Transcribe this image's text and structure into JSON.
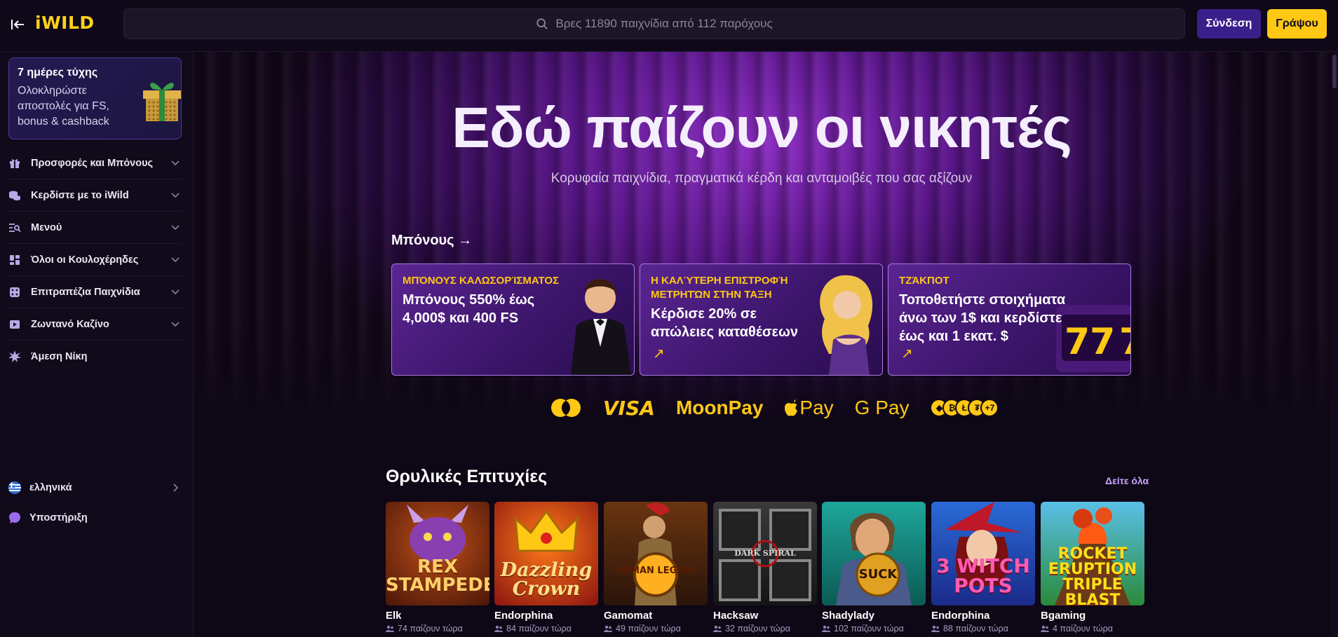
{
  "header": {
    "logo": "iWILD",
    "search_placeholder": "Βρες 11890 παιχνίδια από 112 παρόχους",
    "login_label": "Σύνδεση",
    "register_label": "Γράψου"
  },
  "sidebar": {
    "promo": {
      "title": "7 ημέρες τύχης",
      "text": "Ολοκληρώστε αποστολές για FS, bonus & cashback"
    },
    "items": [
      {
        "label": "Προσφορές και Μπόνους",
        "icon": "gift-icon",
        "expandable": true
      },
      {
        "label": "Κερδίστε με το iWild",
        "icon": "coins-icon",
        "expandable": true
      },
      {
        "label": "Μενού",
        "icon": "menu-search-icon",
        "expandable": true
      },
      {
        "label": "Όλοι οι Κουλοχέρηδες",
        "icon": "grid-icon",
        "expandable": true
      },
      {
        "label": "Επιτραπέζια Παιχνίδια",
        "icon": "dice-icon",
        "expandable": true
      },
      {
        "label": "Ζωντανό Καζίνο",
        "icon": "play-icon",
        "expandable": true
      },
      {
        "label": "Άμεση Νίκη",
        "icon": "burst-icon",
        "expandable": false
      }
    ],
    "language": "ελληνικά",
    "support": "Υποστήριξη"
  },
  "hero": {
    "title": "Εδώ παίζουν οι νικητές",
    "subtitle": "Κορυφαία παιχνίδια, πραγματικά κέρδη και ανταμοιβές που σας αξίζουν"
  },
  "bonus_section": {
    "heading": "Μπόνους →",
    "cards": [
      {
        "tag": "ΜΠΌΝΟΥΣ ΚΑΛΩΣΟΡΊΣΜΑΤΟΣ",
        "text": "Μπόνους 550% έως 4,000$ και 400 FS"
      },
      {
        "tag": "Η ΚΑΛΎΤΕΡΗ ΕΠΙΣΤΡΟΦΉ ΜΕΤΡΗΤΏΝ ΣΤΗΝ ΤΑΞΗ",
        "text": "Κέρδισε 20% σε απώλειες καταθέσεων",
        "arrow": "↗"
      },
      {
        "tag": "ΤΖΆΚΠΟΤ",
        "text": "Τοποθετήστε στοιχήματα άνω των 1$ και κερδίστε έως και 1 εκατ. $",
        "arrow": "↗"
      }
    ]
  },
  "payments": {
    "visa": "VISA",
    "moonpay": "MoonPay",
    "applepay": "Pay",
    "gpay": "G Pay",
    "more": "+7"
  },
  "games_section": {
    "title": "Θρυλικές Επιτυχίες",
    "see_all": "Δείτε όλα",
    "games": [
      {
        "art": "REX STAMPEDE",
        "provider": "Elk",
        "players": "74 παίζουν τώρα"
      },
      {
        "art": "Dazzling Crown",
        "provider": "Endorphina",
        "players": "84 παίζουν τώρα"
      },
      {
        "art": "ROMAN LEGION",
        "provider": "Gamomat",
        "players": "49 παίζουν τώρα"
      },
      {
        "art": "DARK SPIRAL",
        "provider": "Hacksaw",
        "players": "32 παίζουν τώρα"
      },
      {
        "art": "SUCK",
        "provider": "Shadylady",
        "players": "102 παίζουν τώρα"
      },
      {
        "art": "3 WITCH POTS",
        "provider": "Endorphina",
        "players": "88 παίζουν τώρα"
      },
      {
        "art": "ROCKET ERUPTION TRIPLE BLAST",
        "provider": "Bgaming",
        "players": "4 παίζουν τώρα"
      }
    ]
  },
  "colors": {
    "accent_yellow": "#ffc814",
    "login_purple": "#3a1f8a",
    "background": "#0e0716"
  }
}
